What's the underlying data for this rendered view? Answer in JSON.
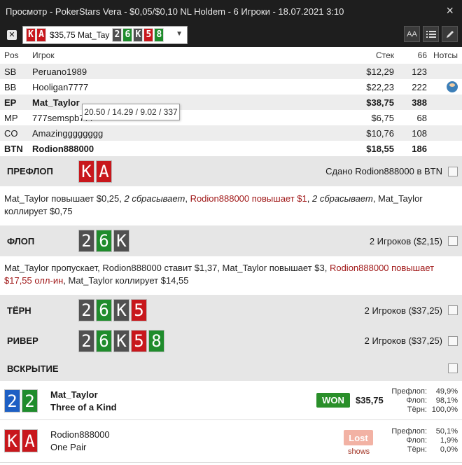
{
  "window": {
    "title": "Просмотр - PokerStars Vera - $0,05/$0,10 NL Holdem - 6 Игроки - 18.07.2021 3:10",
    "close": "×"
  },
  "toolbar": {
    "x_label": "✕",
    "hand_text": "$35,75 Mat_Tay",
    "hand_hole": [
      "K",
      "A"
    ],
    "hand_board": [
      "2",
      "6",
      "K",
      "5",
      "8"
    ],
    "font_btn": "AA"
  },
  "players": {
    "headers": {
      "pos": "Pos",
      "player": "Игрок",
      "stack": "Стек",
      "vpip": "66",
      "notes": "Нотсы"
    },
    "rows": [
      {
        "pos": "SB",
        "name": "Peruano1989",
        "stack": "$12,29",
        "vpip": "123"
      },
      {
        "pos": "BB",
        "name": "Hooligan7777",
        "stack": "$22,23",
        "vpip": "222"
      },
      {
        "pos": "EP",
        "name": "Mat_Taylor",
        "stack": "$38,75",
        "vpip": "388"
      },
      {
        "pos": "MP",
        "name": "777semspb777",
        "stack": "$6,75",
        "vpip": "68"
      },
      {
        "pos": "CO",
        "name": "Amazingggggggg",
        "stack": "$10,76",
        "vpip": "108"
      },
      {
        "pos": "BTN",
        "name": "Rodion888000",
        "stack": "$18,55",
        "vpip": "186"
      }
    ],
    "tooltip": "20.50 / 14.29 / 9.02 / 337"
  },
  "streets": {
    "preflop": {
      "name": "ПРЕФЛОП",
      "info": "Сдано Rodion888000 в BTN",
      "cards": [
        "K",
        "A"
      ],
      "actions": {
        "a1": "Mat_Taylor повышает $0,25, ",
        "a2": "2 сбрасывает",
        "a3": ", ",
        "a4": "Rodion888000 повышает $1",
        "a5": ", ",
        "a6": "2 сбрасывает",
        "a7": ", Mat_Taylor коллирует $0,75"
      }
    },
    "flop": {
      "name": "ФЛОП",
      "info": "2 Игроков ($2,15)",
      "cards": [
        "2",
        "6",
        "K"
      ],
      "actions": {
        "a1": "Mat_Taylor пропускает, Rodion888000 ставит $1,37, Mat_Taylor повышает $3, ",
        "a2": "Rodion888000 повышает $17,55 олл-ин",
        "a3": ", Mat_Taylor коллирует $14,55"
      }
    },
    "turn": {
      "name": "ТЁРН",
      "info": "2 Игроков ($37,25)",
      "cards": [
        "2",
        "6",
        "K",
        "5"
      ]
    },
    "river": {
      "name": "РИВЕР",
      "info": "2 Игроков ($37,25)",
      "cards": [
        "2",
        "6",
        "K",
        "5",
        "8"
      ]
    },
    "showdown": {
      "name": "ВСКРЫТИЕ"
    }
  },
  "results": {
    "winner": {
      "cards": [
        "2",
        "2"
      ],
      "name": "Mat_Taylor",
      "hand": "Three of a Kind",
      "badge": "WON",
      "amount": "$35,75",
      "eq_labels": [
        "Префлоп:",
        "Флоп:",
        "Тёрн:"
      ],
      "eq_values": [
        "49,9%",
        "98,1%",
        "100,0%"
      ]
    },
    "loser": {
      "cards": [
        "K",
        "A"
      ],
      "name": "Rodion888000",
      "hand": "One Pair",
      "badge": "Lost",
      "shows": "shows",
      "eq_labels": [
        "Префлоп:",
        "Флоп:",
        "Тёрн:"
      ],
      "eq_values": [
        "50,1%",
        "1,9%",
        "0,0%"
      ]
    }
  },
  "colors": {
    "red_card": "#c8171c",
    "gray_card": "#505050",
    "green_card": "#1f8c2c",
    "blue_card": "#1d5fc4",
    "won": "#2a8f2a",
    "lost": "#f2b2a4",
    "highlight": "#a01818"
  }
}
